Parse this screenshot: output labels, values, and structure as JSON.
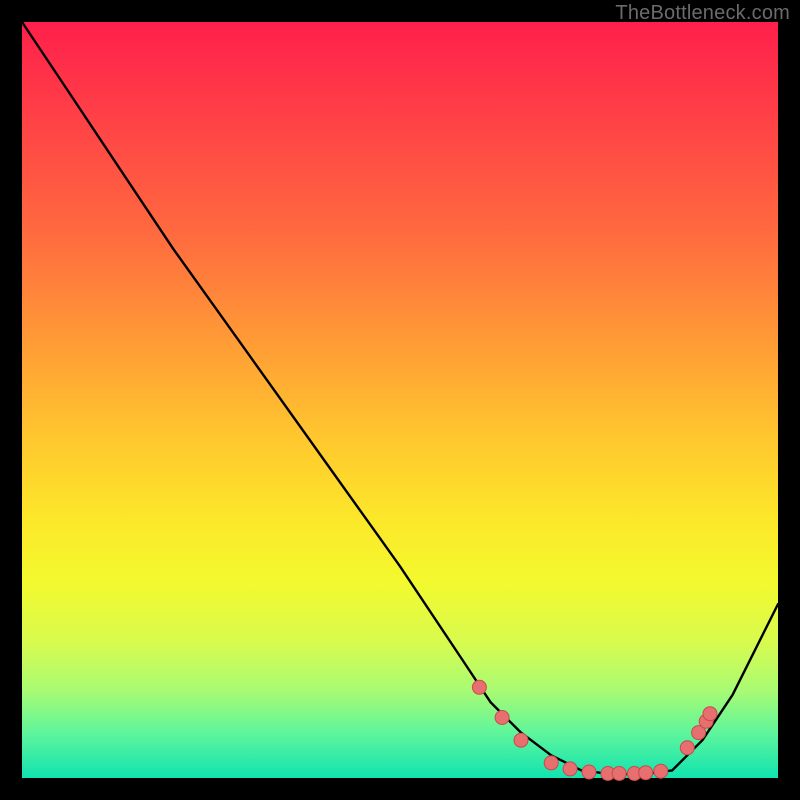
{
  "attribution": "TheBottleneck.com",
  "colors": {
    "page_bg": "#000000",
    "curve": "#000000",
    "marker_fill": "#e76f6f",
    "marker_stroke": "#c94a4a",
    "gradient_top": "#ff1f4b",
    "gradient_bottom": "#11e3b0"
  },
  "chart_data": {
    "type": "line",
    "title": "",
    "xlabel": "",
    "ylabel": "",
    "xlim": [
      0,
      100
    ],
    "ylim": [
      0,
      100
    ],
    "grid": false,
    "legend": false,
    "series": [
      {
        "name": "bottleneck-curve",
        "x": [
          0,
          6,
          12,
          20,
          30,
          40,
          50,
          58,
          62,
          66,
          70,
          74,
          78,
          82,
          86,
          90,
          94,
          100
        ],
        "y": [
          100,
          91,
          82,
          70,
          56,
          42,
          28,
          16,
          10,
          6,
          3,
          1,
          0.5,
          0.5,
          1,
          5,
          11,
          23
        ]
      }
    ],
    "markers": {
      "name": "highlighted-points",
      "x": [
        60.5,
        63.5,
        66,
        70,
        72.5,
        75,
        77.5,
        79,
        81,
        82.5,
        84.5,
        88,
        89.5,
        90.5,
        91
      ],
      "y": [
        12,
        8,
        5,
        2,
        1.2,
        0.8,
        0.6,
        0.6,
        0.6,
        0.7,
        0.9,
        4,
        6,
        7.5,
        8.5
      ]
    }
  }
}
